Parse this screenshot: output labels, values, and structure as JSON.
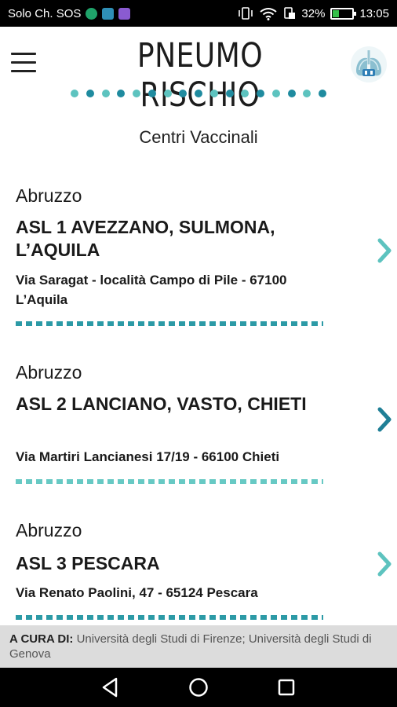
{
  "status_bar": {
    "carrier": "Solo Ch. SOS",
    "battery": "32%",
    "time": "13:05",
    "battery_level": 0.32
  },
  "header": {
    "title": "PNEUMO RISCHIO",
    "logo_icon": "lungs-icon",
    "menu_icon": "hamburger-menu-icon",
    "dot_colors": [
      "#5dc3bf",
      "#1f8b9f",
      "#5dc3bf",
      "#1f8b9f",
      "#5dc3bf",
      "#1f8b9f",
      "#5dc3bf",
      "#1f8b9f",
      "#1f8b9f",
      "#5dc3bf",
      "#1f8b9f",
      "#5dc3bf",
      "#1f8b9f",
      "#5dc3bf",
      "#1f8b9f",
      "#5dc3bf",
      "#1f8b9f"
    ]
  },
  "page": {
    "subtitle": "Centri Vaccinali"
  },
  "centers": [
    {
      "region": "Abruzzo",
      "name": "ASL 1 AVEZZANO, SULMONA, L’AQUILA",
      "address": "Via Saragat - località Campo di Pile - 67100 L’Aquila",
      "chevron_color": "#5dc3bf"
    },
    {
      "region": "Abruzzo",
      "name": "ASL 2 LANCIANO, VASTO, CHIETI",
      "address": "Via Martiri Lancianesi 17/19 - 66100 Chieti",
      "chevron_color": "#1f7f96"
    },
    {
      "region": "Abruzzo",
      "name": "ASL 3 PESCARA",
      "address": "Via Renato Paolini, 47 - 65124 Pescara",
      "chevron_color": "#5dc3bf"
    }
  ],
  "credits": {
    "label": "A CURA DI:",
    "text": "Università degli Studi di Firenze; Università degli Studi di Genova"
  },
  "nav": {
    "back_icon": "back-triangle-icon",
    "home_icon": "home-circle-icon",
    "recents_icon": "recents-square-icon"
  },
  "colors": {
    "accent_dark": "#1f8b9f",
    "accent_light": "#5dc3bf"
  }
}
